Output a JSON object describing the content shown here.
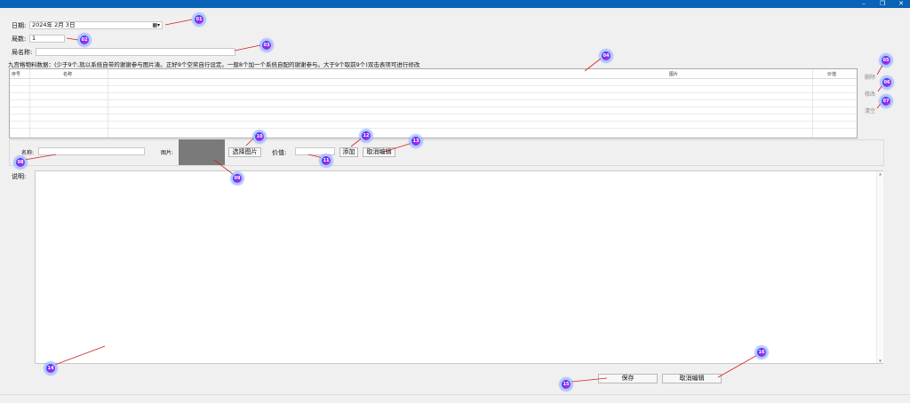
{
  "window": {
    "min": "–",
    "restore": "❐",
    "close": "✕"
  },
  "form": {
    "date_label": "日期:",
    "date_value": "2024年  2月  3日",
    "calendar_icon": "calendar-dropdown-icon",
    "count_label": "局数:",
    "count_value": "1",
    "name_label": "局名称:",
    "name_value": "",
    "instruction": "九宫格物料数据：(少于9个,就以系统自带的谢谢参与图片凑。正好9个空奖自行设定。一般8个加一个系统自配的谢谢参与。大于9个取前9个)双击表项可进行修改"
  },
  "grid": {
    "columns": [
      "序号",
      "名称",
      "图片",
      "价值"
    ],
    "rows": []
  },
  "side_buttons": {
    "delete": "删除",
    "edit": "修改",
    "clear": "清空"
  },
  "editor": {
    "name_label": "名称:",
    "name_value": "",
    "image_label": "图片:",
    "choose_image": "选择图片",
    "value_label": "价值:",
    "value_value": "",
    "add": "添加",
    "cancel_edit": "取消编辑"
  },
  "description": {
    "label": "说明:",
    "value": ""
  },
  "footer": {
    "save": "保存",
    "cancel_edit": "取消编辑"
  },
  "badges": [
    "01",
    "02",
    "03",
    "04",
    "05",
    "06",
    "07",
    "08",
    "09",
    "10",
    "11",
    "12",
    "13",
    "14",
    "15",
    "16"
  ],
  "colors": {
    "titlebar": "#0a63b6",
    "badge_start": "#4a2df0",
    "badge_end": "#c02cf0",
    "arrow": "#d32020"
  }
}
